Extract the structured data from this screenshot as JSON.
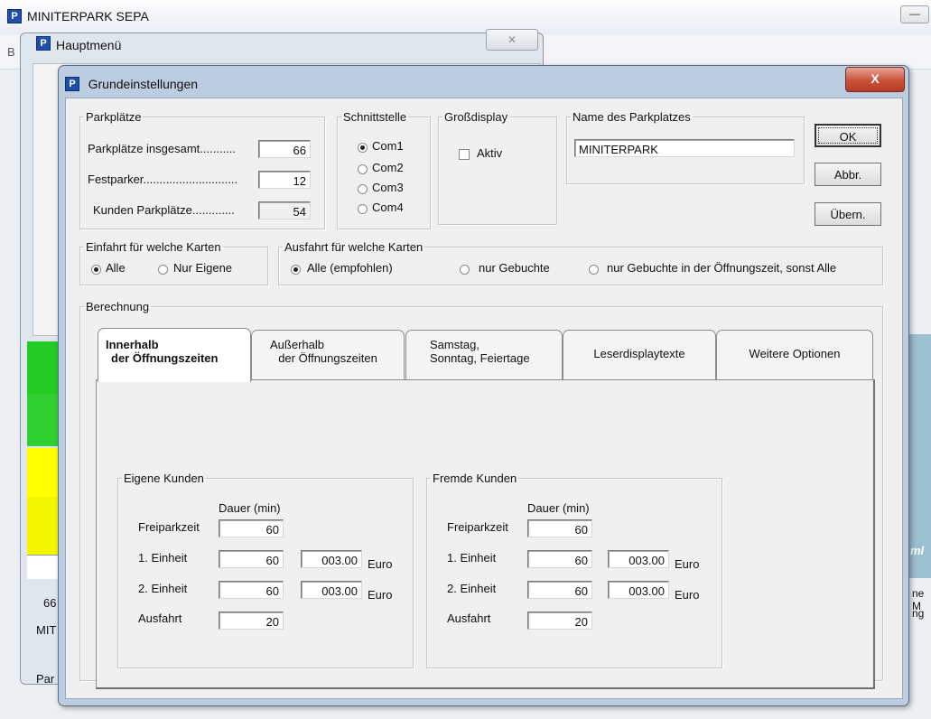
{
  "main_window": {
    "title": "MINITERPARK  SEPA",
    "menu_fragment": "B",
    "left_texts": [
      "66",
      "MIT",
      "Par"
    ],
    "right_texts": [
      "ne M",
      "ng"
    ],
    "watermark": "ml"
  },
  "haupt_window": {
    "title": "Hauptmenü",
    "close_glyph": "✕"
  },
  "dialog": {
    "title": "Grundeinstellungen",
    "close_glyph": "X"
  },
  "parkplaetze": {
    "legend": "Parkplätze",
    "rows": [
      {
        "label": "Parkplätze insgesamt...........",
        "value": "66"
      },
      {
        "label": "Festparker.............................",
        "value": "12"
      },
      {
        "label": "Kunden Parkplätze.............",
        "value": "54"
      }
    ]
  },
  "schnittstelle": {
    "legend": "Schnittstelle",
    "options": [
      "Com1",
      "Com2",
      "Com3",
      "Com4"
    ],
    "selected": 0
  },
  "grossdisplay": {
    "legend": "Großdisplay",
    "checkbox_label": "Aktiv",
    "checked": false
  },
  "name": {
    "legend": "Name des Parkplatzes",
    "value": "MINITERPARK"
  },
  "buttons": {
    "ok": "OK",
    "abbr": "Abbr.",
    "uebern": "Übern."
  },
  "einfahrt": {
    "legend": "Einfahrt für welche Karten",
    "options": [
      "Alle",
      "Nur Eigene"
    ],
    "selected": 0
  },
  "ausfahrt": {
    "legend": "Ausfahrt für welche Karten",
    "options": [
      "Alle (empfohlen)",
      "nur Gebuchte",
      "nur Gebuchte in der Öffnungszeit, sonst Alle"
    ],
    "selected": 0
  },
  "berechnung": {
    "legend": "Berechnung"
  },
  "tabs": [
    {
      "line1": "Innerhalb",
      "line2": "der Öffnungszeiten"
    },
    {
      "line1": "Außerhalb",
      "line2": "der Öffnungszeiten"
    },
    {
      "line1": "Samstag,",
      "line2": "Sonntag, Feiertage"
    },
    {
      "line1": "Leserdisplaytexte",
      "line2": ""
    },
    {
      "line1": "Weitere Optionen",
      "line2": ""
    }
  ],
  "eigene": {
    "legend": "Eigene Kunden",
    "dauer_label": "Dauer (min)",
    "freiparkzeit": {
      "label": "Freiparkzeit",
      "value": "60"
    },
    "einheit1": {
      "label": "1. Einheit",
      "minutes": "60",
      "price": "003.00",
      "unit": "Euro"
    },
    "einheit2": {
      "label": "2. Einheit",
      "minutes": "60",
      "price": "003.00",
      "unit": "Euro"
    },
    "ausfahrt": {
      "label": "Ausfahrt",
      "value": "20"
    }
  },
  "fremde": {
    "legend": "Fremde Kunden",
    "dauer_label": "Dauer (min)",
    "freiparkzeit": {
      "label": "Freiparkzeit",
      "value": "60"
    },
    "einheit1": {
      "label": "1. Einheit",
      "minutes": "60",
      "price": "003.00",
      "unit": "Euro"
    },
    "einheit2": {
      "label": "2. Einheit",
      "minutes": "60",
      "price": "003.00",
      "unit": "Euro"
    },
    "ausfahrt": {
      "label": "Ausfahrt",
      "value": "20"
    }
  },
  "colors": {
    "green": "#22cc22",
    "yellow": "#ffff00",
    "dialog_frame": "#bccde2",
    "close_red": "#c8513a"
  }
}
